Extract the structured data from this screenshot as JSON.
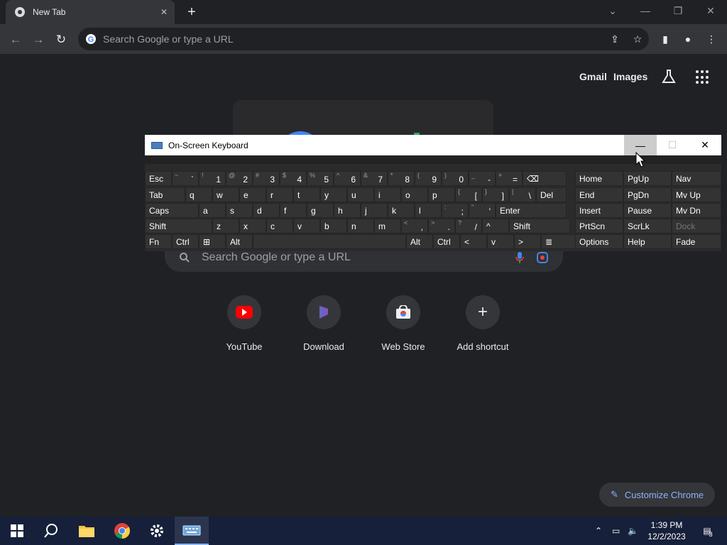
{
  "browser": {
    "tab_title": "New Tab",
    "omnibox_placeholder": "Search Google or type a URL"
  },
  "ntp": {
    "gmail": "Gmail",
    "images": "Images",
    "search_placeholder": "Search Google or type a URL",
    "shortcuts": [
      {
        "label": "YouTube",
        "icon": "youtube-icon"
      },
      {
        "label": "Download",
        "icon": "download-site-icon"
      },
      {
        "label": "Web Store",
        "icon": "web-store-icon"
      },
      {
        "label": "Add shortcut",
        "icon": "plus-icon"
      }
    ],
    "customize": "Customize Chrome"
  },
  "osk": {
    "title": "On-Screen Keyboard",
    "rows": [
      [
        {
          "m": "Esc"
        },
        {
          "s": "~",
          "m": "`"
        },
        {
          "s": "!",
          "m": "1"
        },
        {
          "s": "@",
          "m": "2"
        },
        {
          "s": "#",
          "m": "3"
        },
        {
          "s": "$",
          "m": "4"
        },
        {
          "s": "%",
          "m": "5"
        },
        {
          "s": "^",
          "m": "6"
        },
        {
          "s": "&",
          "m": "7"
        },
        {
          "s": "*",
          "m": "8"
        },
        {
          "s": "(",
          "m": "9"
        },
        {
          "s": ")",
          "m": "0"
        },
        {
          "s": "_",
          "m": "-"
        },
        {
          "s": "+",
          "m": "="
        },
        {
          "m": "⌫"
        }
      ],
      [
        {
          "m": "Tab"
        },
        {
          "m": "q"
        },
        {
          "m": "w"
        },
        {
          "m": "e"
        },
        {
          "m": "r"
        },
        {
          "m": "t"
        },
        {
          "m": "y"
        },
        {
          "m": "u"
        },
        {
          "m": "i"
        },
        {
          "m": "o"
        },
        {
          "m": "p"
        },
        {
          "s": "{",
          "m": "["
        },
        {
          "s": "}",
          "m": "]"
        },
        {
          "s": "|",
          "m": "\\"
        },
        {
          "m": "Del"
        }
      ],
      [
        {
          "m": "Caps"
        },
        {
          "m": "a"
        },
        {
          "m": "s"
        },
        {
          "m": "d"
        },
        {
          "m": "f"
        },
        {
          "m": "g"
        },
        {
          "m": "h"
        },
        {
          "m": "j"
        },
        {
          "m": "k"
        },
        {
          "m": "l"
        },
        {
          "s": ":",
          "m": ";"
        },
        {
          "s": "\"",
          "m": "'"
        },
        {
          "m": "Enter"
        }
      ],
      [
        {
          "m": "Shift"
        },
        {
          "m": "z"
        },
        {
          "m": "x"
        },
        {
          "m": "c"
        },
        {
          "m": "v"
        },
        {
          "m": "b"
        },
        {
          "m": "n"
        },
        {
          "m": "m"
        },
        {
          "s": "<",
          "m": ","
        },
        {
          "s": ">",
          "m": "."
        },
        {
          "s": "?",
          "m": "/"
        },
        {
          "m": "^"
        },
        {
          "m": "Shift"
        }
      ],
      [
        {
          "m": "Fn"
        },
        {
          "m": "Ctrl"
        },
        {
          "m": "⊞"
        },
        {
          "m": "Alt"
        },
        {
          "m": ""
        },
        {
          "m": "Alt"
        },
        {
          "m": "Ctrl"
        },
        {
          "m": "<"
        },
        {
          "m": "v"
        },
        {
          "m": ">"
        },
        {
          "m": "≣"
        }
      ]
    ],
    "side": [
      [
        "Home",
        "PgUp",
        "Nav"
      ],
      [
        "End",
        "PgDn",
        "Mv Up"
      ],
      [
        "Insert",
        "Pause",
        "Mv Dn"
      ],
      [
        "PrtScn",
        "ScrLk",
        "Dock"
      ],
      [
        "Options",
        "Help",
        "Fade"
      ]
    ]
  },
  "taskbar": {
    "time": "1:39 PM",
    "date": "12/2/2023",
    "notifications": "3"
  }
}
